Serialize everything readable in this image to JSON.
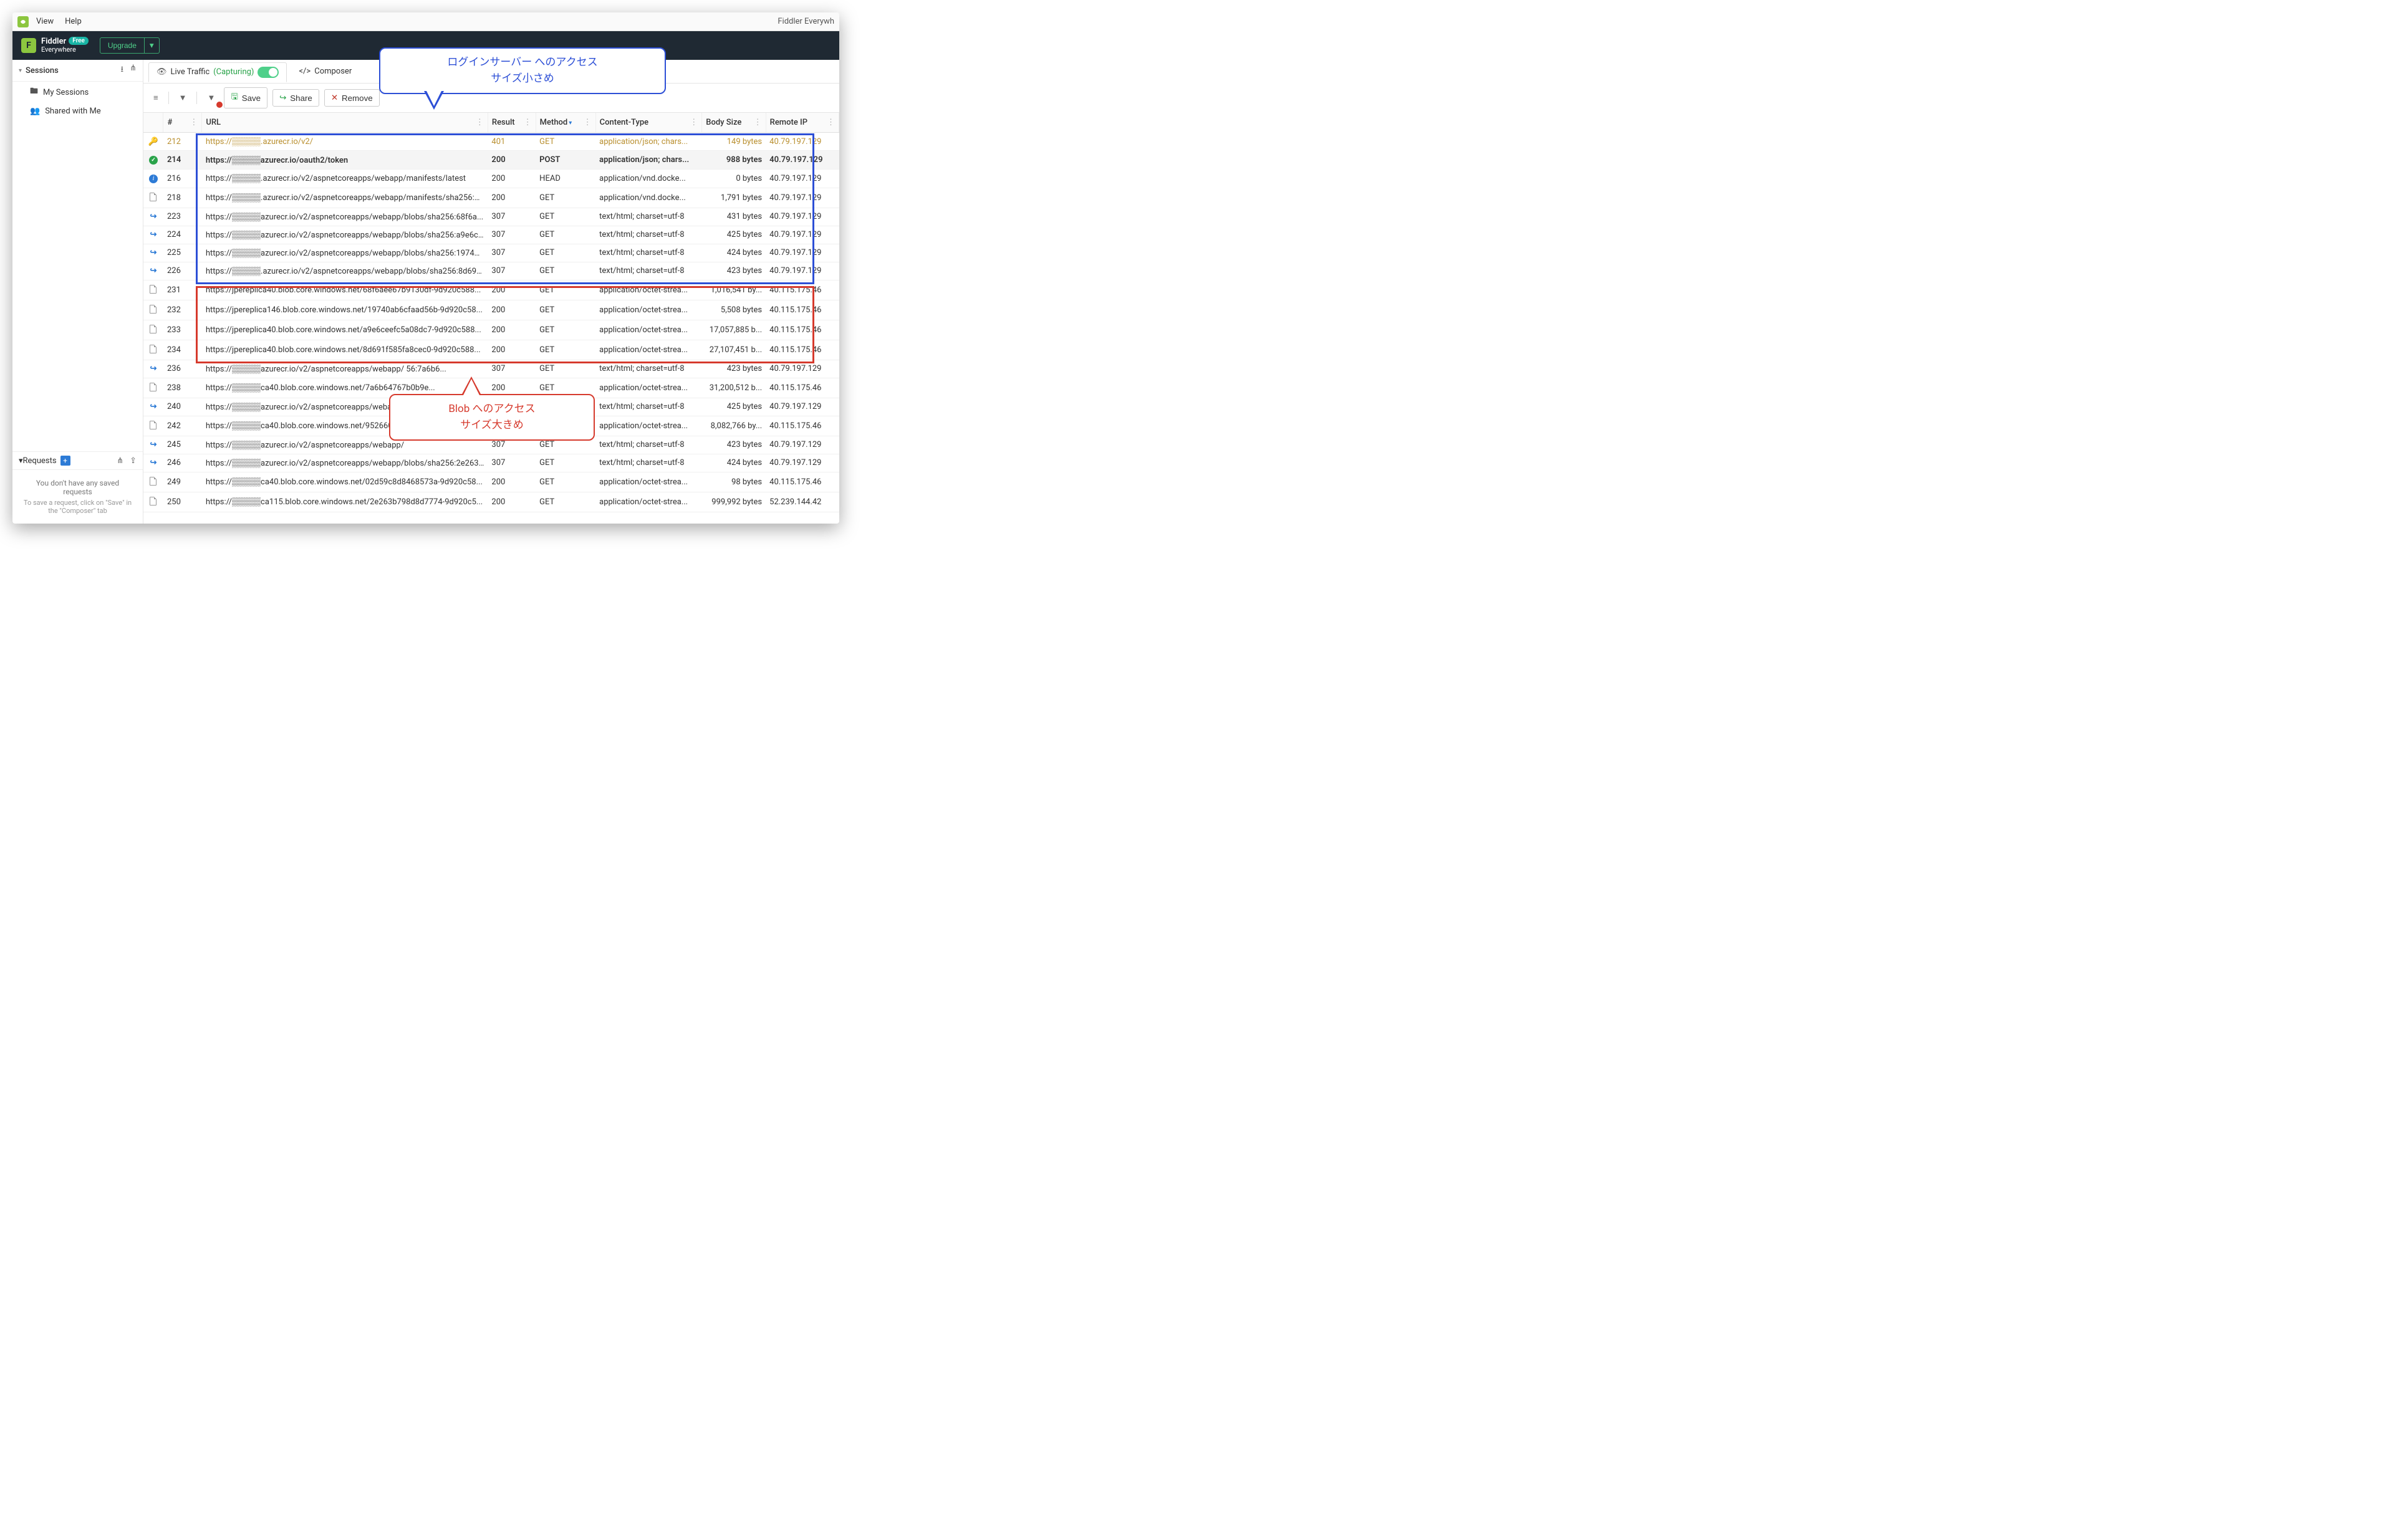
{
  "menubar": {
    "view": "View",
    "help": "Help",
    "title_right": "Fiddler Everywh"
  },
  "header": {
    "logo_letter": "F",
    "product_line1": "Fiddler",
    "product_line2": "Everywhere",
    "free_badge": "Free",
    "upgrade": "Upgrade"
  },
  "sidebar": {
    "sessions_hdr": "Sessions",
    "my_sessions": "My Sessions",
    "shared": "Shared with Me",
    "requests_hdr": "Requests",
    "empty_title": "You don't have any saved requests",
    "empty_hint": "To save a request, click on \"Save\" in the \"Composer\" tab"
  },
  "tabs": {
    "live": "Live Traffic",
    "capturing": "(Capturing)",
    "composer": "Composer"
  },
  "toolbar": {
    "save": "Save",
    "share": "Share",
    "remove": "Remove"
  },
  "columns": {
    "id": "#",
    "url": "URL",
    "result": "Result",
    "method": "Method",
    "content_type": "Content-Type",
    "body_size": "Body Size",
    "remote_ip": "Remote IP"
  },
  "rows": [
    {
      "icon": "key",
      "id": "212",
      "url": "https://▒▒▒▒▒.azurecr.io/v2/",
      "result": "401",
      "method": "GET",
      "ct": "application/json; chars...",
      "size": "149 bytes",
      "ip": "40.79.197.129",
      "cls": "first"
    },
    {
      "icon": "ok",
      "id": "214",
      "url": "https://▒▒▒▒▒azurecr.io/oauth2/token",
      "result": "200",
      "method": "POST",
      "ct": "application/json; chars...",
      "size": "988 bytes",
      "ip": "40.79.197.129",
      "cls": "sel"
    },
    {
      "icon": "info",
      "id": "216",
      "url": "https://▒▒▒▒▒.azurecr.io/v2/aspnetcoreapps/webapp/manifests/latest",
      "result": "200",
      "method": "HEAD",
      "ct": "application/vnd.docke...",
      "size": "0 bytes",
      "ip": "40.79.197.129"
    },
    {
      "icon": "doc",
      "id": "218",
      "url": "https://▒▒▒▒▒.azurecr.io/v2/aspnetcoreapps/webapp/manifests/sha256:2...",
      "result": "200",
      "method": "GET",
      "ct": "application/vnd.docke...",
      "size": "1,791 bytes",
      "ip": "40.79.197.129"
    },
    {
      "icon": "redir",
      "id": "223",
      "url": "https://▒▒▒▒▒azurecr.io/v2/aspnetcoreapps/webapp/blobs/sha256:68f6a...",
      "result": "307",
      "method": "GET",
      "ct": "text/html; charset=utf-8",
      "size": "431 bytes",
      "ip": "40.79.197.129"
    },
    {
      "icon": "redir",
      "id": "224",
      "url": "https://▒▒▒▒▒azurecr.io/v2/aspnetcoreapps/webapp/blobs/sha256:a9e6c...",
      "result": "307",
      "method": "GET",
      "ct": "text/html; charset=utf-8",
      "size": "425 bytes",
      "ip": "40.79.197.129"
    },
    {
      "icon": "redir",
      "id": "225",
      "url": "https://▒▒▒▒▒azurecr.io/v2/aspnetcoreapps/webapp/blobs/sha256:19740...",
      "result": "307",
      "method": "GET",
      "ct": "text/html; charset=utf-8",
      "size": "424 bytes",
      "ip": "40.79.197.129"
    },
    {
      "icon": "redir",
      "id": "226",
      "url": "https://▒▒▒▒▒.azurecr.io/v2/aspnetcoreapps/webapp/blobs/sha256:8d691...",
      "result": "307",
      "method": "GET",
      "ct": "text/html; charset=utf-8",
      "size": "423 bytes",
      "ip": "40.79.197.129"
    },
    {
      "icon": "doc",
      "id": "231",
      "url": "https://jpereplica40.blob.core.windows.net/68f6aee67b9130df-9d920c588...",
      "result": "200",
      "method": "GET",
      "ct": "application/octet-strea...",
      "size": "1,016,541 by...",
      "ip": "40.115.175.46"
    },
    {
      "icon": "doc",
      "id": "232",
      "url": "https://jpereplica146.blob.core.windows.net/19740ab6cfaad56b-9d920c58...",
      "result": "200",
      "method": "GET",
      "ct": "application/octet-strea...",
      "size": "5,508 bytes",
      "ip": "40.115.175.46"
    },
    {
      "icon": "doc",
      "id": "233",
      "url": "https://jpereplica40.blob.core.windows.net/a9e6ceefc5a08dc7-9d920c588...",
      "result": "200",
      "method": "GET",
      "ct": "application/octet-strea...",
      "size": "17,057,885 b...",
      "ip": "40.115.175.46"
    },
    {
      "icon": "doc",
      "id": "234",
      "url": "https://jpereplica40.blob.core.windows.net/8d691f585fa8cec0-9d920c588...",
      "result": "200",
      "method": "GET",
      "ct": "application/octet-strea...",
      "size": "27,107,451 b...",
      "ip": "40.115.175.46"
    },
    {
      "icon": "redir",
      "id": "236",
      "url": "https://▒▒▒▒▒azurecr.io/v2/aspnetcoreapps/webapp/         56:7a6b6...",
      "result": "307",
      "method": "GET",
      "ct": "text/html; charset=utf-8",
      "size": "423 bytes",
      "ip": "40.79.197.129"
    },
    {
      "icon": "doc",
      "id": "238",
      "url": "https://▒▒▒▒▒ca40.blob.core.windows.net/7a6b64767b0b9e...",
      "result": "200",
      "method": "GET",
      "ct": "application/octet-strea...",
      "size": "31,200,512 b...",
      "ip": "40.115.175.46"
    },
    {
      "icon": "redir",
      "id": "240",
      "url": "https://▒▒▒▒▒azurecr.io/v2/aspnetcoreapps/webapp/",
      "result": "307",
      "method": "GET",
      "ct": "text/html; charset=utf-8",
      "size": "425 bytes",
      "ip": "40.79.197.129"
    },
    {
      "icon": "doc",
      "id": "242",
      "url": "https://▒▒▒▒▒ca40.blob.core.windows.net/9526606",
      "result": "200",
      "method": "GET",
      "ct": "application/octet-strea...",
      "size": "8,082,766 by...",
      "ip": "40.115.175.46"
    },
    {
      "icon": "redir",
      "id": "245",
      "url": "https://▒▒▒▒▒azurecr.io/v2/aspnetcoreapps/webapp/",
      "result": "307",
      "method": "GET",
      "ct": "text/html; charset=utf-8",
      "size": "423 bytes",
      "ip": "40.79.197.129"
    },
    {
      "icon": "redir",
      "id": "246",
      "url": "https://▒▒▒▒▒azurecr.io/v2/aspnetcoreapps/webapp/blobs/sha256:2e263...",
      "result": "307",
      "method": "GET",
      "ct": "text/html; charset=utf-8",
      "size": "424 bytes",
      "ip": "40.79.197.129"
    },
    {
      "icon": "doc",
      "id": "249",
      "url": "https://▒▒▒▒▒ca40.blob.core.windows.net/02d59c8d8468573a-9d920c58...",
      "result": "200",
      "method": "GET",
      "ct": "application/octet-strea...",
      "size": "98 bytes",
      "ip": "40.115.175.46"
    },
    {
      "icon": "doc",
      "id": "250",
      "url": "https://▒▒▒▒▒ca115.blob.core.windows.net/2e263b798d8d7774-9d920c5...",
      "result": "200",
      "method": "GET",
      "ct": "application/octet-strea...",
      "size": "999,992 bytes",
      "ip": "52.239.144.42"
    }
  ],
  "annotations": {
    "blue_line1": "ログインサーバー へのアクセス",
    "blue_line2": "サイズ小さめ",
    "red_line1": "Blob へのアクセス",
    "red_line2": "サイズ大きめ"
  }
}
